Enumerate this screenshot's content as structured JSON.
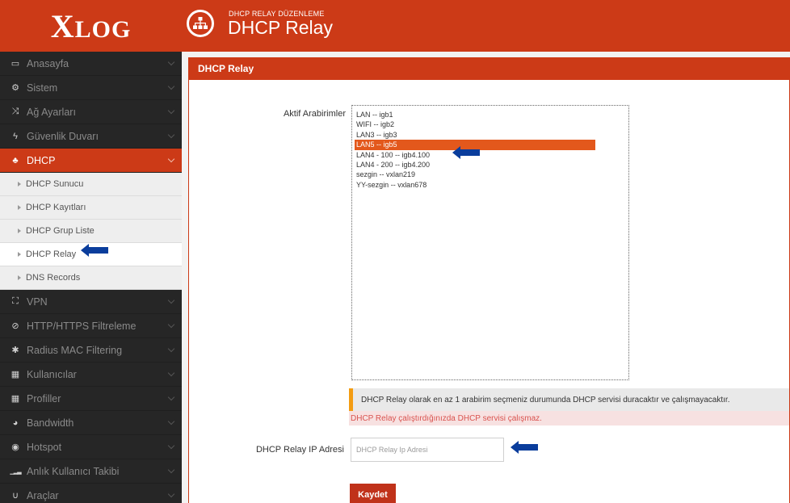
{
  "app": {
    "logo_x": "X",
    "logo_rest": "LOG"
  },
  "header": {
    "subtitle": "DHCP RELAY DÜZENLEME",
    "title": "DHCP Relay"
  },
  "sidebar": {
    "items": [
      {
        "label": "Anasayfa",
        "icon": "laptop-icon",
        "glyph": "▭"
      },
      {
        "label": "Sistem",
        "icon": "gears-icon",
        "glyph": "⚙"
      },
      {
        "label": "Ağ Ayarları",
        "icon": "shuffle-icon",
        "glyph": "⤨"
      },
      {
        "label": "Güvenlik Duvarı",
        "icon": "bolt-icon",
        "glyph": "ϟ"
      },
      {
        "label": "DHCP",
        "icon": "sitemap-icon",
        "glyph": "♣"
      }
    ],
    "sub_items": [
      {
        "label": "DHCP Sunucu"
      },
      {
        "label": "DHCP Kayıtları"
      },
      {
        "label": "DHCP Grup Liste"
      },
      {
        "label": "DHCP Relay"
      },
      {
        "label": "DNS Records"
      }
    ],
    "items_after": [
      {
        "label": "VPN",
        "icon": "binoculars-icon",
        "glyph": "⛶"
      },
      {
        "label": "HTTP/HTTPS Filtreleme",
        "icon": "eye-slash-icon",
        "glyph": "⊘"
      },
      {
        "label": "Radius MAC Filtering",
        "icon": "asterisk-icon",
        "glyph": "✱"
      },
      {
        "label": "Kullanıcılar",
        "icon": "grid-icon",
        "glyph": "▦"
      },
      {
        "label": "Profiller",
        "icon": "grid-icon",
        "glyph": "▦"
      },
      {
        "label": "Bandwidth",
        "icon": "dashboard-icon",
        "glyph": "◕"
      },
      {
        "label": "Hotspot",
        "icon": "globe-icon",
        "glyph": "◉"
      },
      {
        "label": "Anlık Kullanıcı Takibi",
        "icon": "signal-icon",
        "glyph": "▁▂▃"
      },
      {
        "label": "Araçlar",
        "icon": "magnet-icon",
        "glyph": "∪"
      }
    ]
  },
  "panel": {
    "title": "DHCP Relay",
    "active_label": "Aktif Arabirimler",
    "interfaces": [
      "LAN -- igb1",
      "WIFI -- igb2",
      "LAN3 -- igb3",
      "LAN5 -- igb5",
      "LAN4 - 100 -- igb4.100",
      "LAN4 - 200 -- igb4.200",
      "sezgin -- vxlan219",
      "YY-sezgin -- vxlan678"
    ],
    "selected_interface": "LAN5 -- igb5",
    "warning": "DHCP Relay olarak en az 1 arabirim seçmeniz durumunda DHCP servisi duracaktır ve çalışmayacaktır.",
    "error": "DHCP Relay çalıştırdığınızda DHCP servisi çalışmaz.",
    "ip_label": "DHCP Relay IP Adresi",
    "ip_value": "",
    "ip_placeholder": "DHCP Relay Ip Adresi",
    "save_label": "Kaydet"
  },
  "colors": {
    "brand": "#cc3a17",
    "sidebar_bg": "#262626",
    "selected_option": "#e3581c",
    "warning_bar": "#f39c12",
    "error_text": "#d9534f",
    "arrow": "#0a3d9c"
  }
}
